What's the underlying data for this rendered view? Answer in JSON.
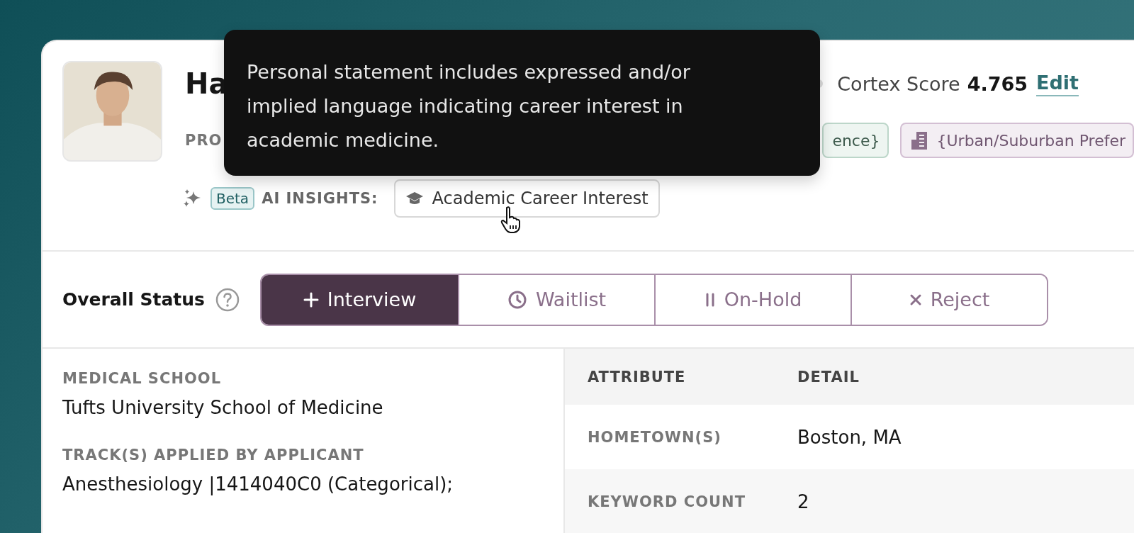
{
  "applicant": {
    "name": "Ha",
    "score_label": "Cortex Score",
    "score": "4.765",
    "edit": "Edit"
  },
  "tags": {
    "label": "PRO",
    "items": [
      {
        "text": "ence}",
        "kind": "green"
      },
      {
        "text": "{Urban/Suburban Prefer",
        "kind": "urban"
      }
    ]
  },
  "ai_insights": {
    "badge": "Beta",
    "label": "AI INSIGHTS:",
    "chips": [
      "Academic Career Interest"
    ]
  },
  "tooltip": {
    "text": "Personal statement includes expressed and/or implied language indicating career interest in academic medicine."
  },
  "status": {
    "label": "Overall Status",
    "options": [
      {
        "label": "Interview",
        "kind": "plus",
        "selected": true
      },
      {
        "label": "Waitlist",
        "kind": "clock",
        "selected": false
      },
      {
        "label": "On-Hold",
        "kind": "pause",
        "selected": false
      },
      {
        "label": "Reject",
        "kind": "x",
        "selected": false
      }
    ]
  },
  "fields": [
    {
      "label": "MEDICAL SCHOOL",
      "value": "Tufts University School of Medicine"
    },
    {
      "label": "TRACK(S) APPLIED BY APPLICANT",
      "value": "Anesthesiology |1414040C0 (Categorical);"
    }
  ],
  "table": {
    "columns": [
      "ATTRIBUTE",
      "DETAIL"
    ],
    "rows": [
      {
        "attribute": "HOMETOWN(S)",
        "detail": "Boston, MA"
      },
      {
        "attribute": "KEYWORD COUNT",
        "detail": "2"
      }
    ]
  }
}
